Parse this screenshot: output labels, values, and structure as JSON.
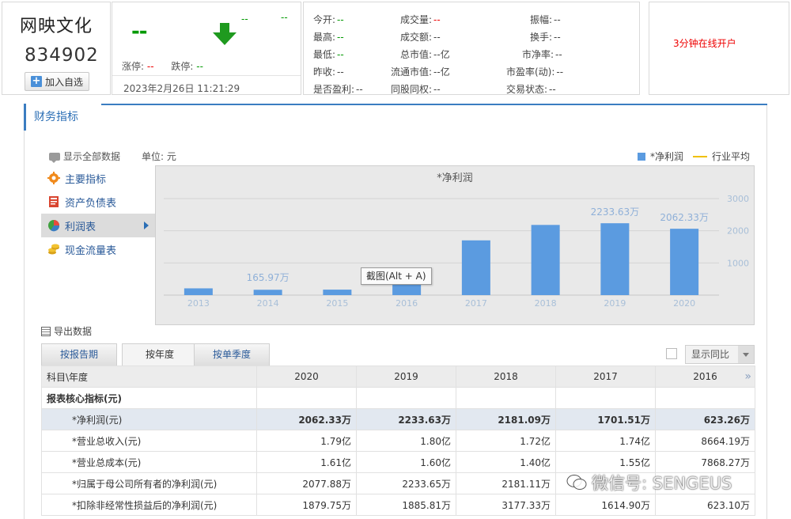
{
  "stock": {
    "name": "网映文化",
    "code": "834902",
    "add_label": "加入自选",
    "price": "--",
    "change1": "--",
    "change2": "--",
    "limit_up_label": "涨停:",
    "limit_up": "--",
    "limit_down_label": "跌停:",
    "limit_down": "--",
    "timestamp": "2023年2月26日 11:21:29"
  },
  "stats": [
    {
      "label": "今开:",
      "value": "--"
    },
    {
      "label": "成交量:",
      "value": "--"
    },
    {
      "label": "振幅:",
      "value": "--"
    },
    {
      "label": "最高:",
      "value": "--"
    },
    {
      "label": "成交额:",
      "value": "--"
    },
    {
      "label": "换手:",
      "value": "--"
    },
    {
      "label": "最低:",
      "value": "--"
    },
    {
      "label": "总市值:",
      "value": "--亿"
    },
    {
      "label": "市净率:",
      "value": "--"
    },
    {
      "label": "昨收:",
      "value": "--"
    },
    {
      "label": "流通市值:",
      "value": "--亿"
    },
    {
      "label": "市盈率(动):",
      "value": "--"
    },
    {
      "label": "是否盈利:",
      "value": "--"
    },
    {
      "label": "同股同权:",
      "value": "--"
    },
    {
      "label": "交易状态:",
      "value": "--"
    }
  ],
  "ad": {
    "label": "3分钟在线开户"
  },
  "panel": {
    "title": "财务指标",
    "show_all": "显示全部数据",
    "unit": "单位: 元",
    "legend_series": "*净利润",
    "legend_avg": "行业平均",
    "export": "导出数据",
    "tooltip": "截图(Alt + A)"
  },
  "menu": [
    {
      "label": "主要指标"
    },
    {
      "label": "资产负债表"
    },
    {
      "label": "利润表"
    },
    {
      "label": "现金流量表"
    }
  ],
  "colors": {
    "bar": "#5b9be0",
    "avg_line": "#f0c000",
    "accent": "#3b7dc1"
  },
  "chart_data": {
    "type": "bar",
    "title": "*净利润",
    "categories": [
      "2013",
      "2014",
      "2015",
      "2016",
      "2017",
      "2018",
      "2019",
      "2020"
    ],
    "series": [
      {
        "name": "*净利润",
        "values": [
          210,
          165.97,
          170,
          623.26,
          1701.51,
          2181.09,
          2233.63,
          2062.33
        ]
      }
    ],
    "data_labels": [
      {
        "index": 1,
        "text": "165.97万"
      },
      {
        "index": 6,
        "text": "2233.63万"
      },
      {
        "index": 7,
        "text": "2062.33万"
      }
    ],
    "yticks": [
      "1000",
      "2000",
      "3000"
    ],
    "ylim": [
      0,
      3000
    ],
    "grid": true
  },
  "tabs": [
    {
      "label": "按报告期"
    },
    {
      "label": "按年度"
    },
    {
      "label": "按单季度"
    }
  ],
  "yoy_label": "显示同比",
  "table": {
    "header_first": "科目\\年度",
    "years": [
      "2020",
      "2019",
      "2018",
      "2017",
      "2016"
    ],
    "section": "报表核心指标(元)",
    "rows": [
      {
        "label": "*净利润(元)",
        "values": [
          "2062.33万",
          "2233.63万",
          "2181.09万",
          "1701.51万",
          "623.26万"
        ]
      },
      {
        "label": "*营业总收入(元)",
        "values": [
          "1.79亿",
          "1.80亿",
          "1.72亿",
          "1.74亿",
          "8664.19万"
        ]
      },
      {
        "label": "*营业总成本(元)",
        "values": [
          "1.61亿",
          "1.60亿",
          "1.40亿",
          "1.55亿",
          "7868.27万"
        ]
      },
      {
        "label": "*归属于母公司所有者的净利润(元)",
        "values": [
          "2077.88万",
          "2233.65万",
          "2181.11万",
          "",
          ""
        ]
      },
      {
        "label": "*扣除非经常性损益后的净利润(元)",
        "values": [
          "1879.75万",
          "1885.81万",
          "3177.33万",
          "1614.90万",
          "623.10万"
        ]
      }
    ]
  },
  "watermark": "微信号: SENGEUS"
}
